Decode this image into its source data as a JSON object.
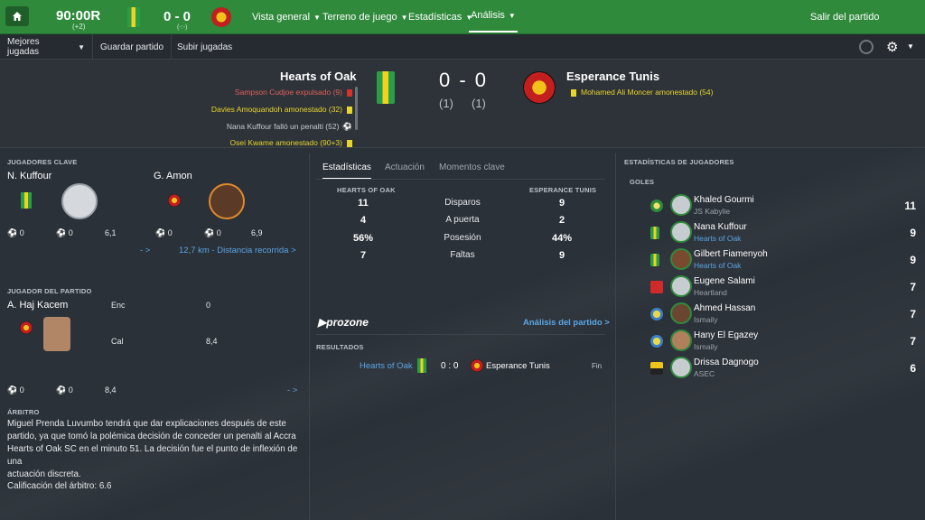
{
  "topbar": {
    "clock": "90:00R",
    "clock_extra": "(+2)",
    "score": "0 - 0",
    "score_sub": "(-:-)",
    "nav": [
      {
        "label": "Vista general"
      },
      {
        "label": "Terreno de juego"
      },
      {
        "label": "Estadísticas"
      },
      {
        "label": "Análisis"
      }
    ],
    "leave_label": "Salir del partido"
  },
  "subbar": {
    "best_plays": "Mejores jugadas",
    "save_match": "Guardar partido",
    "upload_plays": "Subir jugadas"
  },
  "match": {
    "home_team": "Hearts of Oak",
    "away_team": "Esperance Tunis",
    "score": "0 - 0",
    "home_pen": "(1)",
    "away_pen": "(1)",
    "home_events": [
      {
        "text": "Sampson Cudjoe expulsado (9)",
        "type": "red"
      },
      {
        "text": "Davies Amoquandoh amonestado (32)",
        "type": "yellow"
      },
      {
        "text": "Nana Kuffour falló un penalti (52)",
        "type": "grey"
      },
      {
        "text": "Osei Kwame amonestado (90+3)",
        "type": "yellow"
      }
    ],
    "away_events": [
      {
        "text": "Mohamed Ali Moncer amonestado (54)",
        "type": "yellow"
      }
    ]
  },
  "key_players": {
    "title": "JUGADORES CLAVE",
    "home": {
      "name": "N. Kuffour",
      "goals": "0",
      "assists": "0",
      "rating": "6,1"
    },
    "away": {
      "name": "G. Amon",
      "goals": "0",
      "assists": "0",
      "rating": "6,9"
    },
    "nav_arrow": "- >",
    "distance_link": "12,7 km - Distancia recorrida >"
  },
  "potm": {
    "title": "JUGADOR DEL PARTIDO",
    "name": "A. Haj Kacem",
    "stat1_label": "Enc",
    "stat1_value": "0",
    "stat2_label": "Cal",
    "stat2_value": "8,4",
    "goals": "0",
    "assists": "0",
    "rating": "8,4",
    "nav_arrow": "- >"
  },
  "referee": {
    "title": "ÁRBITRO",
    "text_lines": [
      "Miguel Prenda Luvumbo tendrá que dar explicaciones después de este",
      "partido, ya que tomó la polémica decisión de conceder un penalti al Accra",
      "Hearts of Oak SC en el minuto 51. La decisión fue el punto de inflexión de una",
      "actuación discreta."
    ],
    "rating": "Calificación del árbitro: 6.6"
  },
  "stats": {
    "tabs": [
      "Estadísticas",
      "Actuación",
      "Momentos clave"
    ],
    "home_header": "HEARTS OF OAK",
    "away_header": "ESPERANCE TUNIS",
    "rows": [
      {
        "home": "11",
        "label": "Disparos",
        "away": "9"
      },
      {
        "home": "4",
        "label": "A puerta",
        "away": "2"
      },
      {
        "home": "56%",
        "label": "Posesión",
        "away": "44%"
      },
      {
        "home": "7",
        "label": "Faltas",
        "away": "9"
      }
    ],
    "prozone": "prozone",
    "analysis_link": "Análisis del partido >",
    "results_title": "RESULTADOS",
    "result": {
      "home": "Hearts of Oak",
      "score": "0 : 0",
      "away": "Esperance Tunis",
      "status": "Fin"
    }
  },
  "player_stats": {
    "title": "ESTADÍSTICAS DE JUGADORES",
    "subtitle": "GOLES",
    "rows": [
      {
        "name": "Khaled Gourmi",
        "team": "JS Kabylie",
        "value": "11",
        "team_link": false
      },
      {
        "name": "Nana Kuffour",
        "team": "Hearts of Oak",
        "value": "9",
        "team_link": true
      },
      {
        "name": "Gilbert Fiamenyoh",
        "team": "Hearts of Oak",
        "value": "9",
        "team_link": true
      },
      {
        "name": "Eugene Salami",
        "team": "Heartland",
        "value": "7",
        "team_link": false
      },
      {
        "name": "Ahmed Hassan",
        "team": "Ismaily",
        "value": "7",
        "team_link": false
      },
      {
        "name": "Hany El Egazey",
        "team": "Ismaily",
        "value": "7",
        "team_link": false
      },
      {
        "name": "Drissa Dagnogo",
        "team": "ASEC",
        "value": "6",
        "team_link": false
      }
    ]
  },
  "colors": {
    "accent_green": "#2f8a3c",
    "link_blue": "#59a6e8",
    "yellow_card": "#e8d52c",
    "red_card": "#d6322a"
  }
}
